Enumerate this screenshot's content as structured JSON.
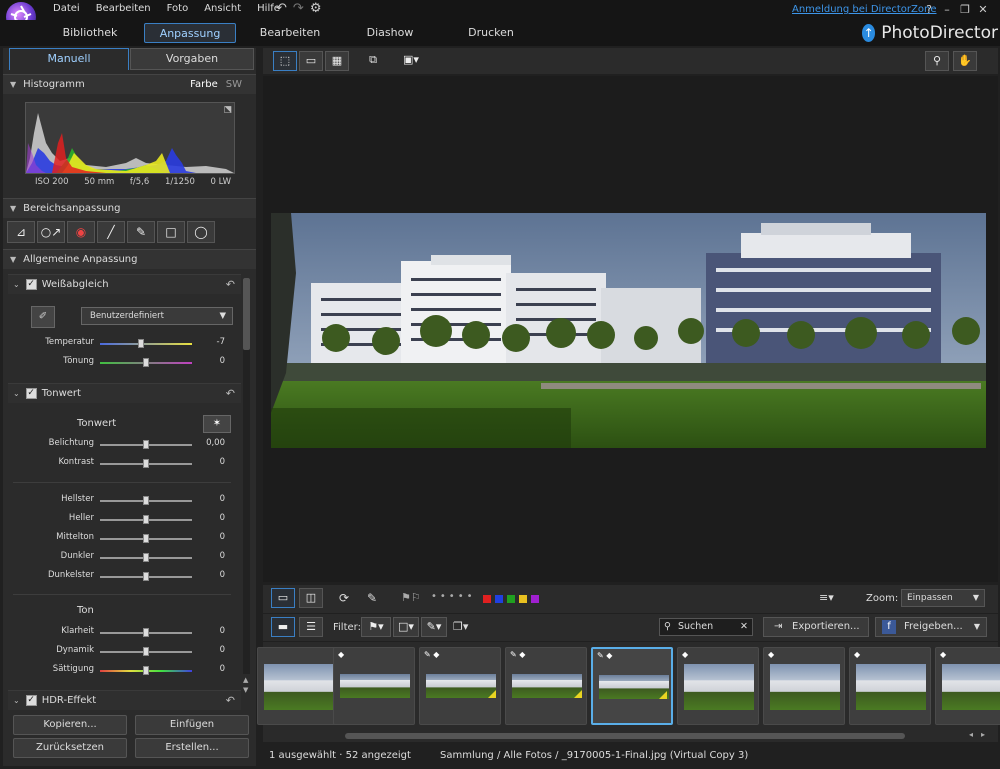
{
  "menu": [
    "Datei",
    "Bearbeiten",
    "Foto",
    "Ansicht",
    "Hilfe"
  ],
  "login_link": "Anmeldung bei DirectorZone",
  "modules": {
    "bibliothek": "Bibliothek",
    "anpassung": "Anpassung",
    "bearbeiten": "Bearbeiten",
    "diashow": "Diashow",
    "drucken": "Drucken"
  },
  "brand": "PhotoDirector",
  "panel_tabs": {
    "manuell": "Manuell",
    "vorgaben": "Vorgaben"
  },
  "histogram": {
    "title": "Histogramm",
    "farbe": "Farbe",
    "sw": "SW",
    "iso": "ISO 200",
    "focal": "50 mm",
    "aperture": "f/5,6",
    "shutter": "1/1250",
    "ev": "0 LW"
  },
  "bereich": {
    "title": "Bereichsanpassung"
  },
  "allgemein": {
    "title": "Allgemeine Anpassung"
  },
  "wb": {
    "title": "Weißabgleich",
    "preset": "Benutzerdefiniert",
    "sliders": [
      {
        "label": "Temperatur",
        "value": "-7",
        "pos": 0.45
      },
      {
        "label": "Tönung",
        "value": "0",
        "pos": 0.5
      }
    ]
  },
  "tonwert": {
    "title": "Tonwert",
    "subtitle": "Tonwert",
    "sliders1": [
      {
        "label": "Belichtung",
        "value": "0,00",
        "pos": 0.5
      },
      {
        "label": "Kontrast",
        "value": "0",
        "pos": 0.5
      }
    ],
    "sliders2": [
      {
        "label": "Hellster",
        "value": "0",
        "pos": 0.5
      },
      {
        "label": "Heller",
        "value": "0",
        "pos": 0.5
      },
      {
        "label": "Mittelton",
        "value": "0",
        "pos": 0.5
      },
      {
        "label": "Dunkler",
        "value": "0",
        "pos": 0.5
      },
      {
        "label": "Dunkelster",
        "value": "0",
        "pos": 0.5
      }
    ],
    "ton_title": "Ton",
    "sliders3": [
      {
        "label": "Klarheit",
        "value": "0",
        "pos": 0.5
      },
      {
        "label": "Dynamik",
        "value": "0",
        "pos": 0.5
      },
      {
        "label": "Sättigung",
        "value": "0",
        "pos": 0.5
      }
    ]
  },
  "hdr": {
    "title": "HDR-Effekt"
  },
  "buttons": {
    "kopieren": "Kopieren...",
    "einfuegen": "Einfügen",
    "zuruecksetzen": "Zurücksetzen",
    "erstellen": "Erstellen..."
  },
  "zoom": {
    "label": "Zoom:",
    "value": "Einpassen"
  },
  "filter": {
    "label": "Filter:"
  },
  "search": {
    "placeholder": "Suchen"
  },
  "export_label": "Exportieren...",
  "share_label": "Freigeben...",
  "status": {
    "left": "1 ausgewählt · 52 angezeigt",
    "path": "Sammlung / Alle Fotos / _9170005-1-Final.jpg (Virtual Copy 3)"
  },
  "colors": {
    "accent": "#3a7fc4",
    "red": "#e02020",
    "blue": "#2040e0",
    "green": "#20a020",
    "yellow": "#e8c020",
    "purple": "#a020d0"
  }
}
